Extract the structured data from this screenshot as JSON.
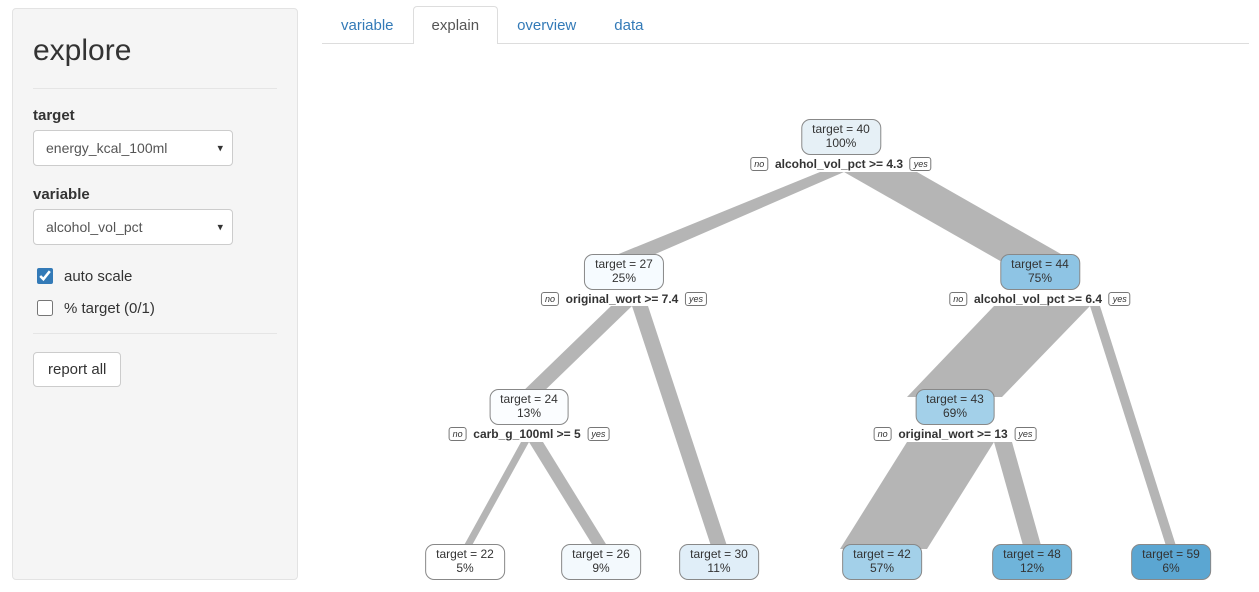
{
  "sidebar": {
    "title": "explore",
    "target_label": "target",
    "target_value": "energy_kcal_100ml",
    "variable_label": "variable",
    "variable_value": "alcohol_vol_pct",
    "auto_scale_label": "auto scale",
    "pct_target_label": "% target (0/1)",
    "report_all_label": "report all"
  },
  "tabs": {
    "variable": "variable",
    "explain": "explain",
    "overview": "overview",
    "data": "data"
  },
  "tree": {
    "no_label": "no",
    "yes_label": "yes",
    "nodes": {
      "root": {
        "target": "target = 40",
        "pct": "100%",
        "split": "alcohol_vol_pct >= 4.3",
        "fill": "#e6f0f6"
      },
      "L": {
        "target": "target = 27",
        "pct": "25%",
        "split": "original_wort >= 7.4",
        "fill": "#f6fbff"
      },
      "R": {
        "target": "target = 44",
        "pct": "75%",
        "split": "alcohol_vol_pct >= 6.4",
        "fill": "#8ec4e4"
      },
      "LL": {
        "target": "target = 24",
        "pct": "13%",
        "split": "carb_g_100ml >= 5",
        "fill": "#fbfdff"
      },
      "RL": {
        "target": "target = 43",
        "pct": "69%",
        "split": "original_wort >= 13",
        "fill": "#a3d0e9"
      },
      "leaf1": {
        "target": "target = 22",
        "pct": "5%",
        "fill": "#ffffff"
      },
      "leaf2": {
        "target": "target = 26",
        "pct": "9%",
        "fill": "#f3f9fd"
      },
      "leaf3": {
        "target": "target = 30",
        "pct": "11%",
        "fill": "#e0eef8"
      },
      "leaf4": {
        "target": "target = 42",
        "pct": "57%",
        "fill": "#a3d0e9"
      },
      "leaf5": {
        "target": "target = 48",
        "pct": "12%",
        "fill": "#6fb4da"
      },
      "leaf6": {
        "target": "target = 59",
        "pct": "6%",
        "fill": "#5ba6d2"
      }
    }
  }
}
